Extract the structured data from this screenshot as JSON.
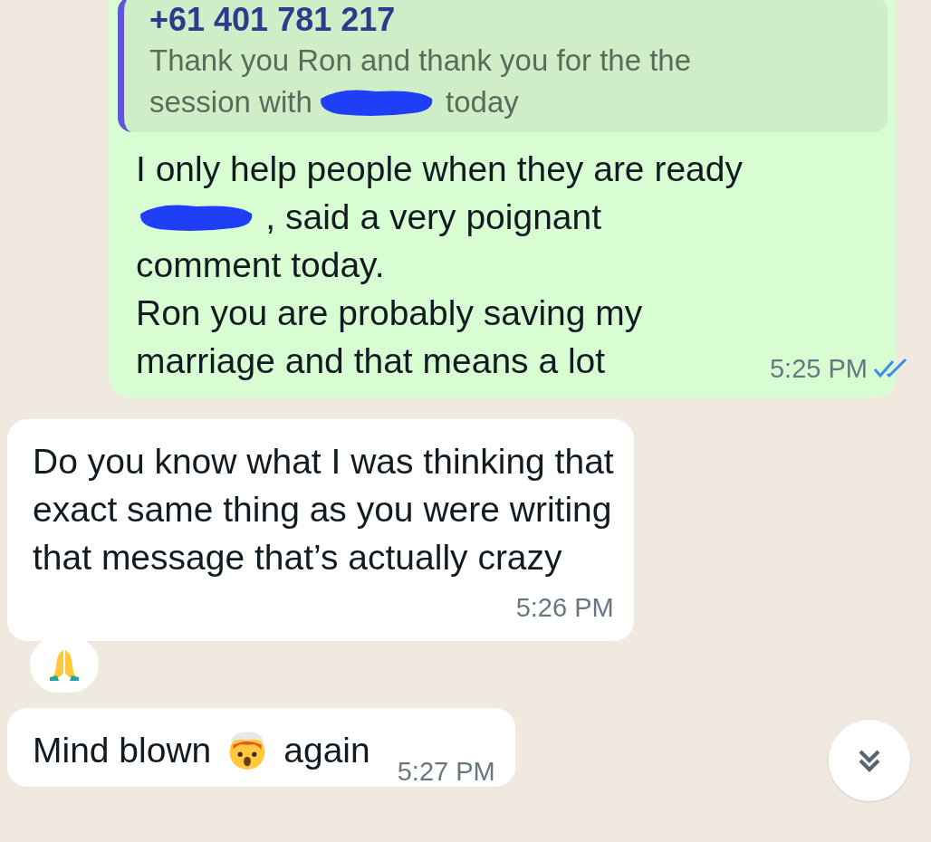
{
  "messages": [
    {
      "kind": "outgoing",
      "quote": {
        "sender": "+61 401 781 217",
        "lines": [
          [
            {
              "kind": "text",
              "text": "Thank you Ron and thank you for the the"
            }
          ],
          [
            {
              "kind": "text",
              "text": "session with"
            },
            {
              "kind": "redacted"
            },
            {
              "kind": "text",
              "text": "today"
            }
          ]
        ]
      },
      "lines": [
        [
          {
            "kind": "text",
            "text": "I only help people when they are ready"
          }
        ],
        [
          {
            "kind": "redacted"
          },
          {
            "kind": "text",
            "text": ", said a very poignant"
          }
        ],
        [
          {
            "kind": "text",
            "text": "comment today."
          }
        ],
        [
          {
            "kind": "text",
            "text": "Ron you are probably saving my"
          }
        ],
        [
          {
            "kind": "text",
            "text": "marriage and that means a lot"
          }
        ]
      ],
      "time": "5:25 PM",
      "read": true
    },
    {
      "kind": "incoming",
      "lines": [
        [
          {
            "kind": "text",
            "text": "Do you know what I was thinking that"
          }
        ],
        [
          {
            "kind": "text",
            "text": "exact same thing as you were writing"
          }
        ],
        [
          {
            "kind": "text",
            "text": "that message that’s actually crazy"
          }
        ]
      ],
      "time": "5:26 PM",
      "reacted": true
    },
    {
      "kind": "incoming",
      "lines": [
        [
          {
            "kind": "text",
            "text": "Mind blown"
          },
          {
            "kind": "emoji"
          },
          {
            "kind": "text",
            "text": "again"
          }
        ]
      ],
      "time": "5:27 PM"
    }
  ],
  "scroll_button": true
}
